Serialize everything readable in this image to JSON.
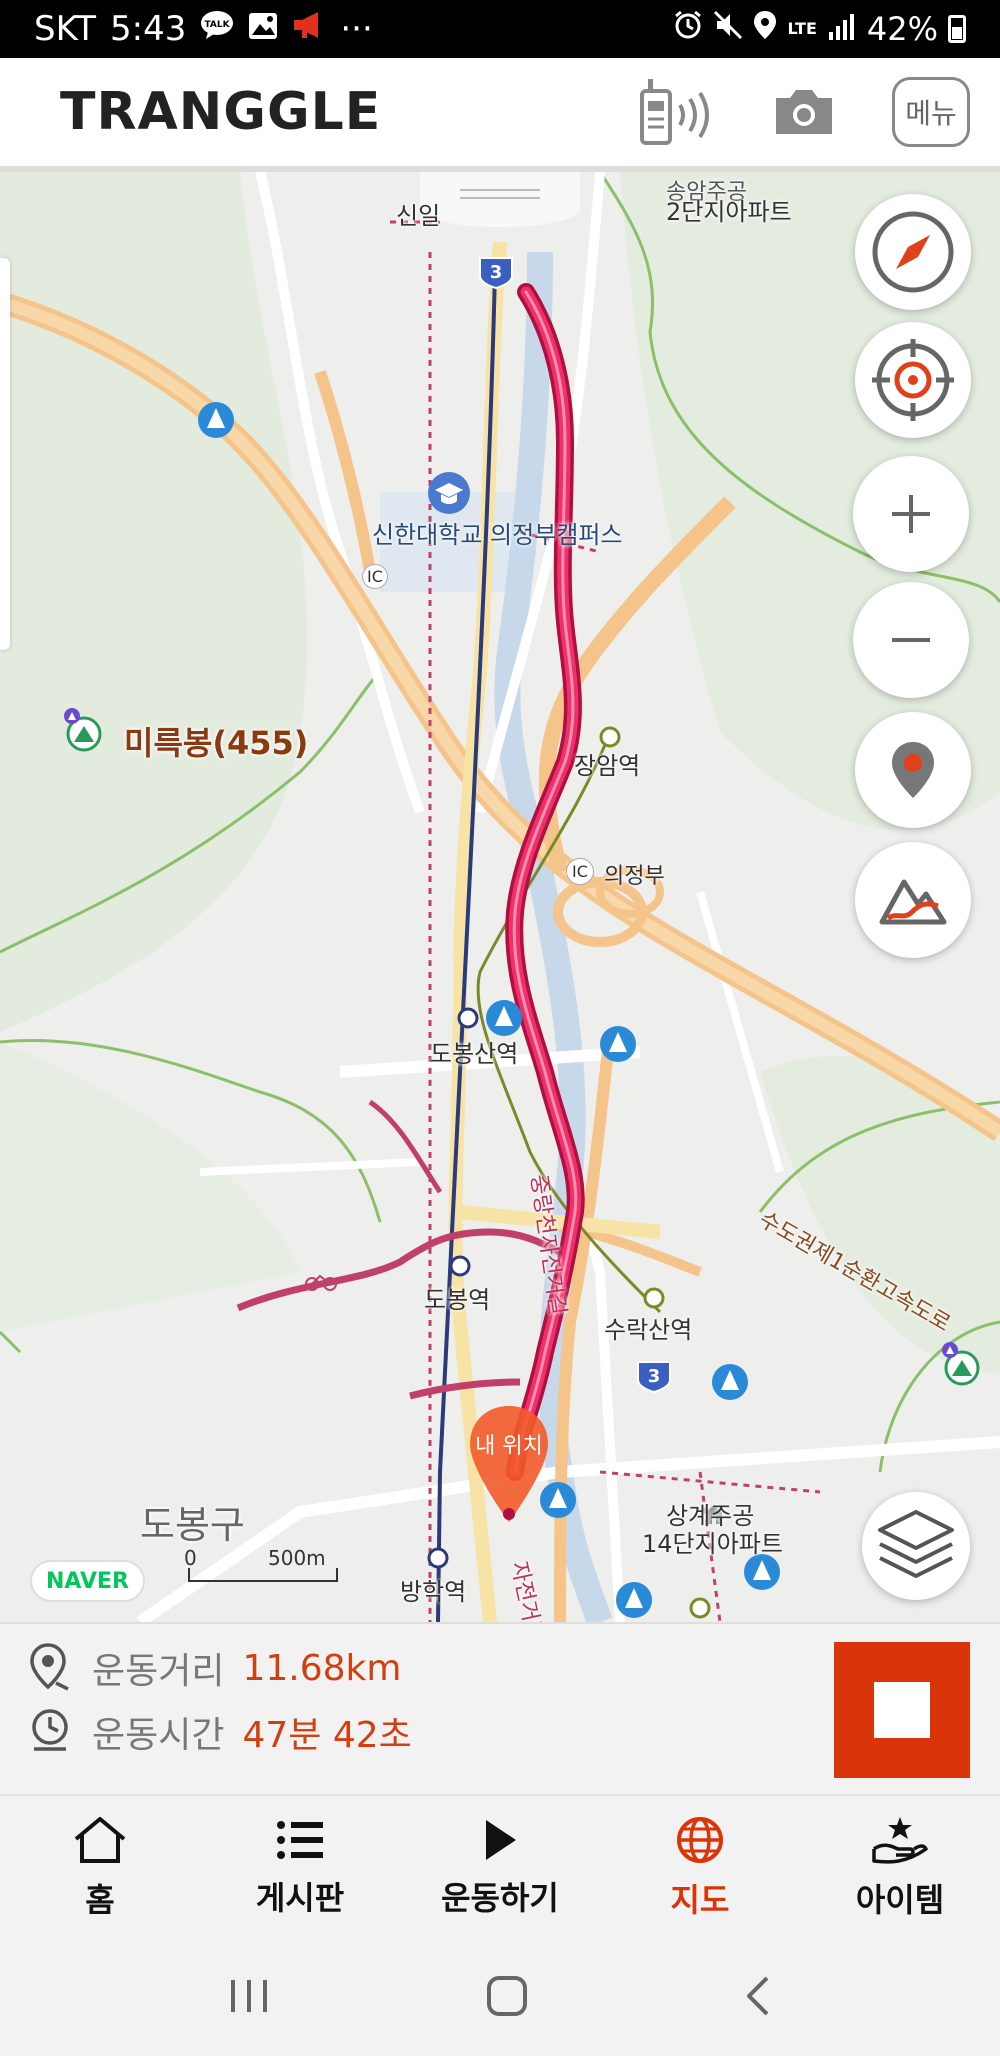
{
  "status_bar": {
    "carrier": "SKT",
    "time": "5:43",
    "talk_badge": "TALK",
    "more": "···",
    "network": "LTE",
    "battery": "42%"
  },
  "header": {
    "logo": "TRANGGLE",
    "menu_label": "메뉴"
  },
  "map": {
    "labels": {
      "apartment_top": "2단지아파트",
      "apartment_top_partial": "송암주공",
      "top_left_partial": "신일",
      "campus": "신한대학교 의정부캠퍼스",
      "ic_small": "IC",
      "peak": "미륵봉(455)",
      "station_jangam": "장암역",
      "ic_uijeongbu_badge": "IC",
      "ic_uijeongbu": "의정부",
      "station_dobongsan": "도봉산역",
      "station_dobong": "도봉역",
      "station_surak": "수락산역",
      "district": "도봉구",
      "station_banghak": "방학역",
      "apartment_bottom_1": "상계주공",
      "apartment_bottom_2": "14단지아파트",
      "highway": "수도권제1순환고속도로",
      "bike_road": "중랑천자전거길",
      "bike_road_partial": "자전거길",
      "route_badge_top": "3",
      "route_badge_bottom": "3"
    },
    "my_location_label": "내 위치",
    "naver_logo": "NAVER",
    "scale_zero": "0",
    "scale_value": "500m"
  },
  "stats": {
    "distance_label": "운동거리",
    "distance_value": "11.68km",
    "time_label": "운동시간",
    "time_value": "47분 42초"
  },
  "bottom_nav": {
    "items": [
      {
        "label": "홈",
        "icon": "home-icon"
      },
      {
        "label": "게시판",
        "icon": "list-icon"
      },
      {
        "label": "운동하기",
        "icon": "play-icon"
      },
      {
        "label": "지도",
        "icon": "globe-icon",
        "active": true
      },
      {
        "label": "아이템",
        "icon": "item-hand-star-icon"
      }
    ]
  },
  "colors": {
    "accent": "#d9340a",
    "track": "#e8205a",
    "road": "#f4c48a",
    "water": "#c6d8ea"
  }
}
